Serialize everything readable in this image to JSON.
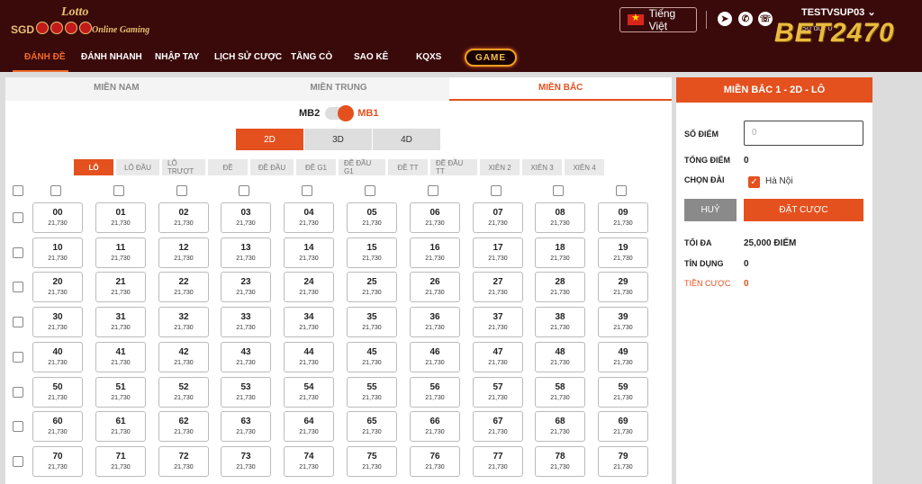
{
  "header": {
    "logo": {
      "lotto": "Lotto",
      "sgd": "SGD",
      "online_gaming": "Online Gaming"
    },
    "language": "Tiếng Việt",
    "username": "TESTVSUP03",
    "brand": "BET2470",
    "balance": "Số dư: 0"
  },
  "nav": {
    "items": [
      "ĐÁNH ĐỀ",
      "ĐÁNH NHANH",
      "NHẬP TAY",
      "LỊCH SỬ CƯỢC",
      "TĂNG CÒ",
      "SAO KÊ",
      "KQXS"
    ],
    "game": "GAME"
  },
  "region_tabs": [
    "MIỀN NAM",
    "MIỀN TRUNG",
    "MIỀN BẮC"
  ],
  "toggle": {
    "left": "MB2",
    "right": "MB1"
  },
  "digit_tabs": [
    "2D",
    "3D",
    "4D"
  ],
  "bet_types": [
    "LÔ",
    "LÔ ĐẦU",
    "LÔ TRƯỢT",
    "ĐỀ",
    "ĐỀ ĐẦU",
    "ĐỀ G1",
    "ĐỀ ĐẦU G1",
    "ĐỀ TT",
    "ĐỀ ĐẦU TT",
    "XIÊN 2",
    "XIÊN 3",
    "XIÊN 4"
  ],
  "grid": {
    "odds": "21,730",
    "numbers": [
      [
        "00",
        "01",
        "02",
        "03",
        "04",
        "05",
        "06",
        "07",
        "08",
        "09"
      ],
      [
        "10",
        "11",
        "12",
        "13",
        "14",
        "15",
        "16",
        "17",
        "18",
        "19"
      ],
      [
        "20",
        "21",
        "22",
        "23",
        "24",
        "25",
        "26",
        "27",
        "28",
        "29"
      ],
      [
        "30",
        "31",
        "32",
        "33",
        "34",
        "35",
        "36",
        "37",
        "38",
        "39"
      ],
      [
        "40",
        "41",
        "42",
        "43",
        "44",
        "45",
        "46",
        "47",
        "48",
        "49"
      ],
      [
        "50",
        "51",
        "52",
        "53",
        "54",
        "55",
        "56",
        "57",
        "58",
        "59"
      ],
      [
        "60",
        "61",
        "62",
        "63",
        "64",
        "65",
        "66",
        "67",
        "68",
        "69"
      ],
      [
        "70",
        "71",
        "72",
        "73",
        "74",
        "75",
        "76",
        "77",
        "78",
        "79"
      ]
    ]
  },
  "bet_panel": {
    "title": "MIỀN BẮC 1 - 2D - LÔ",
    "so_diem_label": "SỐ ĐIỂM",
    "so_diem_placeholder": "0",
    "tong_diem_label": "TỔNG ĐIỂM",
    "tong_diem_value": "0",
    "chon_dai_label": "CHỌN ĐÀI",
    "chon_dai_value": "Hà Nội",
    "cancel_label": "HUỶ",
    "submit_label": "ĐẶT CƯỢC",
    "toi_da_label": "TỐI ĐA",
    "toi_da_value": "25,000 ĐIỂM",
    "tin_dung_label": "TÍN DỤNG",
    "tin_dung_value": "0",
    "tien_cuoc_label": "TIỀN CƯỢC",
    "tien_cuoc_value": "0"
  }
}
